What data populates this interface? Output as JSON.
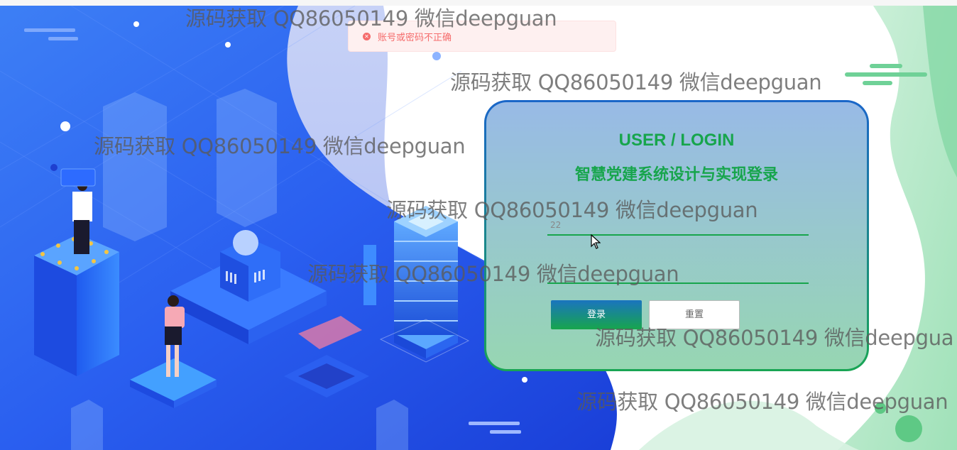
{
  "alert": {
    "icon": "error-circle-icon",
    "message": "账号或密码不正确",
    "color": "#f56c6c"
  },
  "login": {
    "title_en": "USER / LOGIN",
    "title_cn": "智慧党建系统设计与实现登录",
    "username_value": "22",
    "password_value": "",
    "login_button": "登录",
    "reset_button": "重置",
    "accent_color": "#17a54c",
    "border_top_color": "#1a66c9"
  },
  "watermarks": [
    "源码获取 QQ86050149 微信deepguan",
    "源码获取 QQ86050149 微信deepguan",
    "源码获取 QQ86050149 微信deepguan",
    "源码获取 QQ86050149 微信deepguan",
    "源码获取 QQ86050149 微信deepguan",
    "源码获取 QQ86050149 微信deepgua",
    "源码获取 QQ86050149 微信deepguan"
  ],
  "icons": {
    "cursor": "mouse-pointer-icon",
    "background": "isometric-tech-illustration"
  }
}
